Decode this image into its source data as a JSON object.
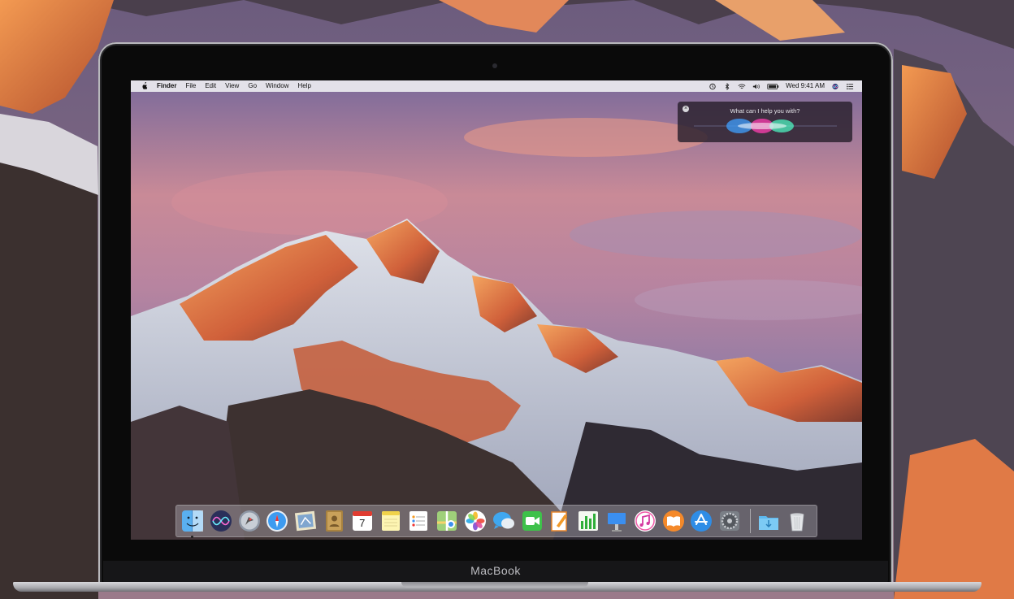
{
  "device": {
    "label": "MacBook"
  },
  "menubar": {
    "app": "Finder",
    "items": [
      "File",
      "Edit",
      "View",
      "Go",
      "Window",
      "Help"
    ],
    "clock": "Wed 9:41 AM"
  },
  "siri": {
    "prompt": "What can I help you with?"
  },
  "dock": {
    "apps": [
      {
        "name": "finder-icon"
      },
      {
        "name": "siri-icon"
      },
      {
        "name": "launchpad-icon"
      },
      {
        "name": "safari-icon"
      },
      {
        "name": "mail-icon"
      },
      {
        "name": "contacts-icon"
      },
      {
        "name": "calendar-icon",
        "day": "7"
      },
      {
        "name": "notes-icon"
      },
      {
        "name": "reminders-icon"
      },
      {
        "name": "maps-icon"
      },
      {
        "name": "photos-icon"
      },
      {
        "name": "messages-icon"
      },
      {
        "name": "facetime-icon"
      },
      {
        "name": "pages-icon"
      },
      {
        "name": "numbers-icon"
      },
      {
        "name": "keynote-icon"
      },
      {
        "name": "itunes-icon"
      },
      {
        "name": "ibooks-icon"
      },
      {
        "name": "app-store-icon"
      },
      {
        "name": "system-preferences-icon"
      }
    ],
    "extras": [
      {
        "name": "downloads-folder-icon"
      },
      {
        "name": "trash-icon"
      }
    ]
  },
  "colors": {
    "accent_orange": "#e8743a",
    "dock_glass": "#d2cdd7",
    "menubar": "#ececf0"
  }
}
